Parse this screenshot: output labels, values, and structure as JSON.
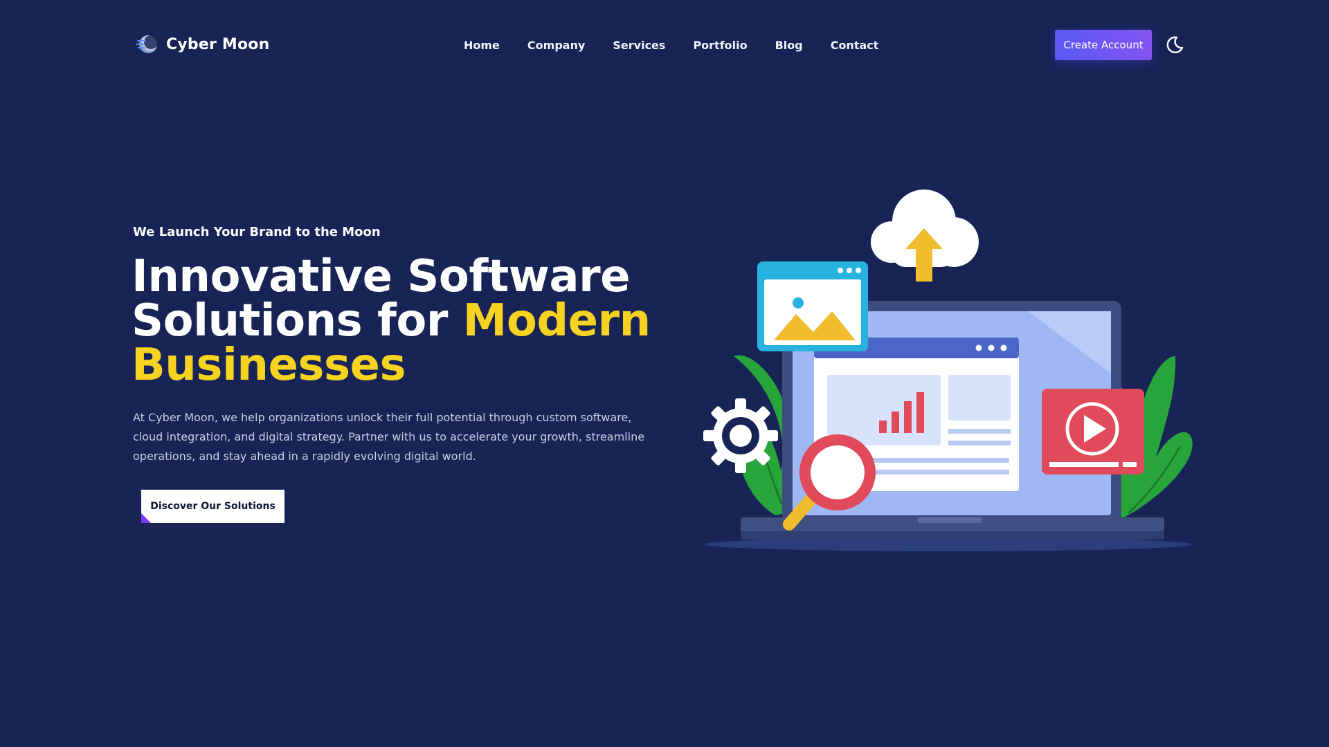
{
  "brand": {
    "name": "Cyber Moon",
    "logo_icon": "moon-logo-icon"
  },
  "nav": {
    "items": [
      {
        "label": "Home"
      },
      {
        "label": "Company"
      },
      {
        "label": "Services"
      },
      {
        "label": "Portfolio"
      },
      {
        "label": "Blog"
      },
      {
        "label": "Contact"
      }
    ]
  },
  "header": {
    "cta_label": "Create Account",
    "theme_toggle_icon": "moon-icon"
  },
  "hero": {
    "eyebrow": "We Launch Your Brand to the Moon",
    "headline_line1": "Innovative Software",
    "headline_line2_prefix": "Solutions for ",
    "headline_highlight1": "Modern",
    "headline_highlight2": "Businesses",
    "description": "At Cyber Moon, we help organizations unlock their full potential through custom software, cloud integration, and digital strategy. Partner with us to accelerate your growth, streamline operations, and stay ahead in a rapidly evolving digital world.",
    "button_label": "Discover Our Solutions"
  },
  "colors": {
    "background": "#172455",
    "accent_yellow": "#f6d320",
    "cta_gradient_start": "#5a58f4",
    "cta_gradient_end": "#8353f2",
    "corner_accent": "#7a3ef0"
  },
  "illustration": {
    "icons": [
      "cloud-upload-icon",
      "image-icon",
      "gear-icon",
      "magnifier-icon",
      "video-play-icon",
      "laptop-icon",
      "bar-chart-icon",
      "leaf-icon"
    ]
  }
}
